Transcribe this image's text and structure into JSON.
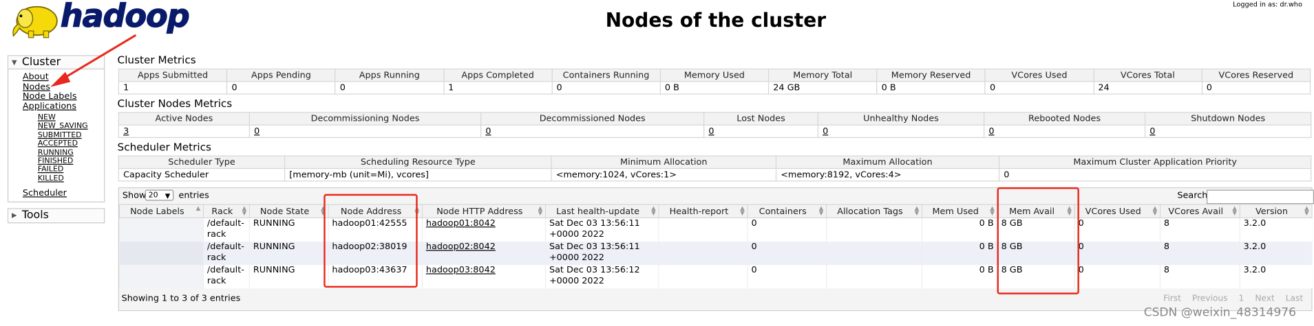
{
  "header": {
    "brand": "hadoop",
    "title": "Nodes of the cluster",
    "logged_in": "Logged in as: dr.who"
  },
  "sidebar": {
    "cluster_label": "Cluster",
    "links": [
      "About",
      "Nodes",
      "Node Labels",
      "Applications"
    ],
    "app_states": [
      "NEW",
      "NEW_SAVING",
      "SUBMITTED",
      "ACCEPTED",
      "RUNNING",
      "FINISHED",
      "FAILED",
      "KILLED"
    ],
    "scheduler": "Scheduler",
    "tools_label": "Tools"
  },
  "cluster_metrics": {
    "title": "Cluster Metrics",
    "headers": [
      "Apps Submitted",
      "Apps Pending",
      "Apps Running",
      "Apps Completed",
      "Containers Running",
      "Memory Used",
      "Memory Total",
      "Memory Reserved",
      "VCores Used",
      "VCores Total",
      "VCores Reserved"
    ],
    "values": [
      "1",
      "0",
      "0",
      "1",
      "0",
      "0 B",
      "24 GB",
      "0 B",
      "0",
      "24",
      "0"
    ]
  },
  "node_metrics": {
    "title": "Cluster Nodes Metrics",
    "headers": [
      "Active Nodes",
      "Decommissioning Nodes",
      "Decommissioned Nodes",
      "Lost Nodes",
      "Unhealthy Nodes",
      "Rebooted Nodes",
      "Shutdown Nodes"
    ],
    "values": [
      "3",
      "0",
      "0",
      "0",
      "0",
      "0",
      "0"
    ]
  },
  "scheduler_metrics": {
    "title": "Scheduler Metrics",
    "headers": [
      "Scheduler Type",
      "Scheduling Resource Type",
      "Minimum Allocation",
      "Maximum Allocation",
      "Maximum Cluster Application Priority"
    ],
    "values": [
      "Capacity Scheduler",
      "[memory-mb (unit=Mi), vcores]",
      "<memory:1024, vCores:1>",
      "<memory:8192, vCores:4>",
      "0"
    ]
  },
  "nodes_table": {
    "show_label": "Show",
    "page_size": "20",
    "entries_label": "entries",
    "search_label": "Search:",
    "search_value": "",
    "headers": [
      "Node Labels",
      "Rack",
      "Node State",
      "Node Address",
      "Node HTTP Address",
      "Last health-update",
      "Health-report",
      "Containers",
      "Allocation Tags",
      "Mem Used",
      "Mem Avail",
      "VCores Used",
      "VCores Avail",
      "Version"
    ],
    "rows": [
      [
        "",
        "/default-rack",
        "RUNNING",
        "hadoop01:42555",
        "hadoop01:8042",
        "Sat Dec 03 13:56:11 +0000 2022",
        "",
        "0",
        "",
        "0 B",
        "8 GB",
        "0",
        "8",
        "3.2.0"
      ],
      [
        "",
        "/default-rack",
        "RUNNING",
        "hadoop02:38019",
        "hadoop02:8042",
        "Sat Dec 03 13:56:11 +0000 2022",
        "",
        "0",
        "",
        "0 B",
        "8 GB",
        "0",
        "8",
        "3.2.0"
      ],
      [
        "",
        "/default-rack",
        "RUNNING",
        "hadoop03:43637",
        "hadoop03:8042",
        "Sat Dec 03 13:56:12 +0000 2022",
        "",
        "0",
        "",
        "0 B",
        "8 GB",
        "0",
        "8",
        "3.2.0"
      ]
    ],
    "info": "Showing 1 to 3 of 3 entries",
    "pager": [
      "First",
      "Previous",
      "1",
      "Next",
      "Last"
    ]
  },
  "watermark": "CSDN @weixin_48314976",
  "colors": {
    "annotation": "#e8281c",
    "logo": "#0a1a6b",
    "logo_elephant": "#f5d90a"
  }
}
